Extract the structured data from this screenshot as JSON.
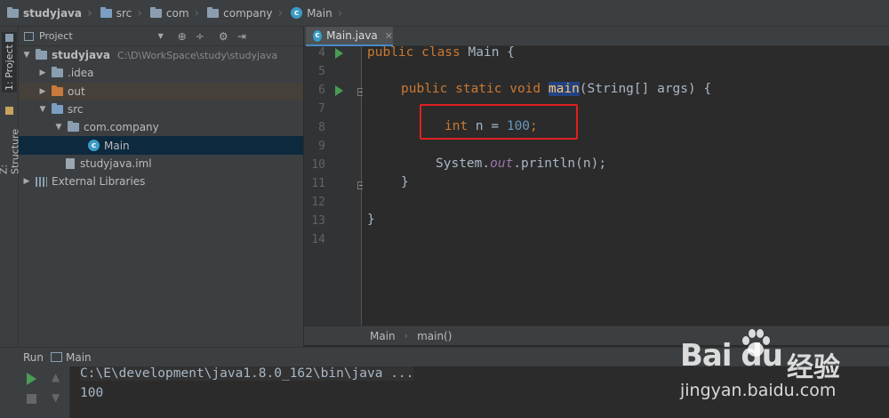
{
  "navbar": {
    "crumbs": [
      "studyjava",
      "src",
      "com",
      "company",
      "Main"
    ]
  },
  "left_strip": {
    "project_tab": "1: Project",
    "structure_tab": "Z: Structure"
  },
  "project_panel": {
    "title": "Project",
    "tree": [
      {
        "label": "studyjava",
        "path": "C:\\D\\WorkSpace\\study\\studyjava"
      },
      {
        "label": ".idea"
      },
      {
        "label": "out"
      },
      {
        "label": "src"
      },
      {
        "label": "com.company"
      },
      {
        "label": "Main"
      },
      {
        "label": "studyjava.iml"
      },
      {
        "label": "External Libraries"
      }
    ]
  },
  "editor": {
    "tab_label": "Main.java",
    "line_numbers": [
      "4",
      "5",
      "6",
      "7",
      "8",
      "9",
      "10",
      "11",
      "12",
      "13",
      "14"
    ],
    "code": {
      "l4_kw": "public class ",
      "l4_rest": "Main {",
      "l6_kw": "public static void ",
      "l6_fn": "main",
      "l6_rest": "(String[] args) {",
      "l8_kw": "int ",
      "l8_mid": "n = ",
      "l8_num": "100",
      "l8_end": ";",
      "l10_a": "System.",
      "l10_b": "out",
      "l10_c": ".println(n);",
      "l11": "}",
      "l13": "}"
    },
    "breadcrumb": [
      "Main",
      "main()"
    ]
  },
  "run_panel": {
    "label": "Run",
    "config": "Main",
    "console": [
      "C:\\E\\development\\java1.8.0_162\\bin\\java ...",
      "100"
    ]
  },
  "watermark": {
    "logo": "Bai du",
    "cn": "经验",
    "url": "jingyan.baidu.com"
  },
  "colors": {
    "keyword": "#cc7832",
    "number": "#6897bb",
    "highlight_box": "#e02020",
    "run_green": "#499c54"
  }
}
